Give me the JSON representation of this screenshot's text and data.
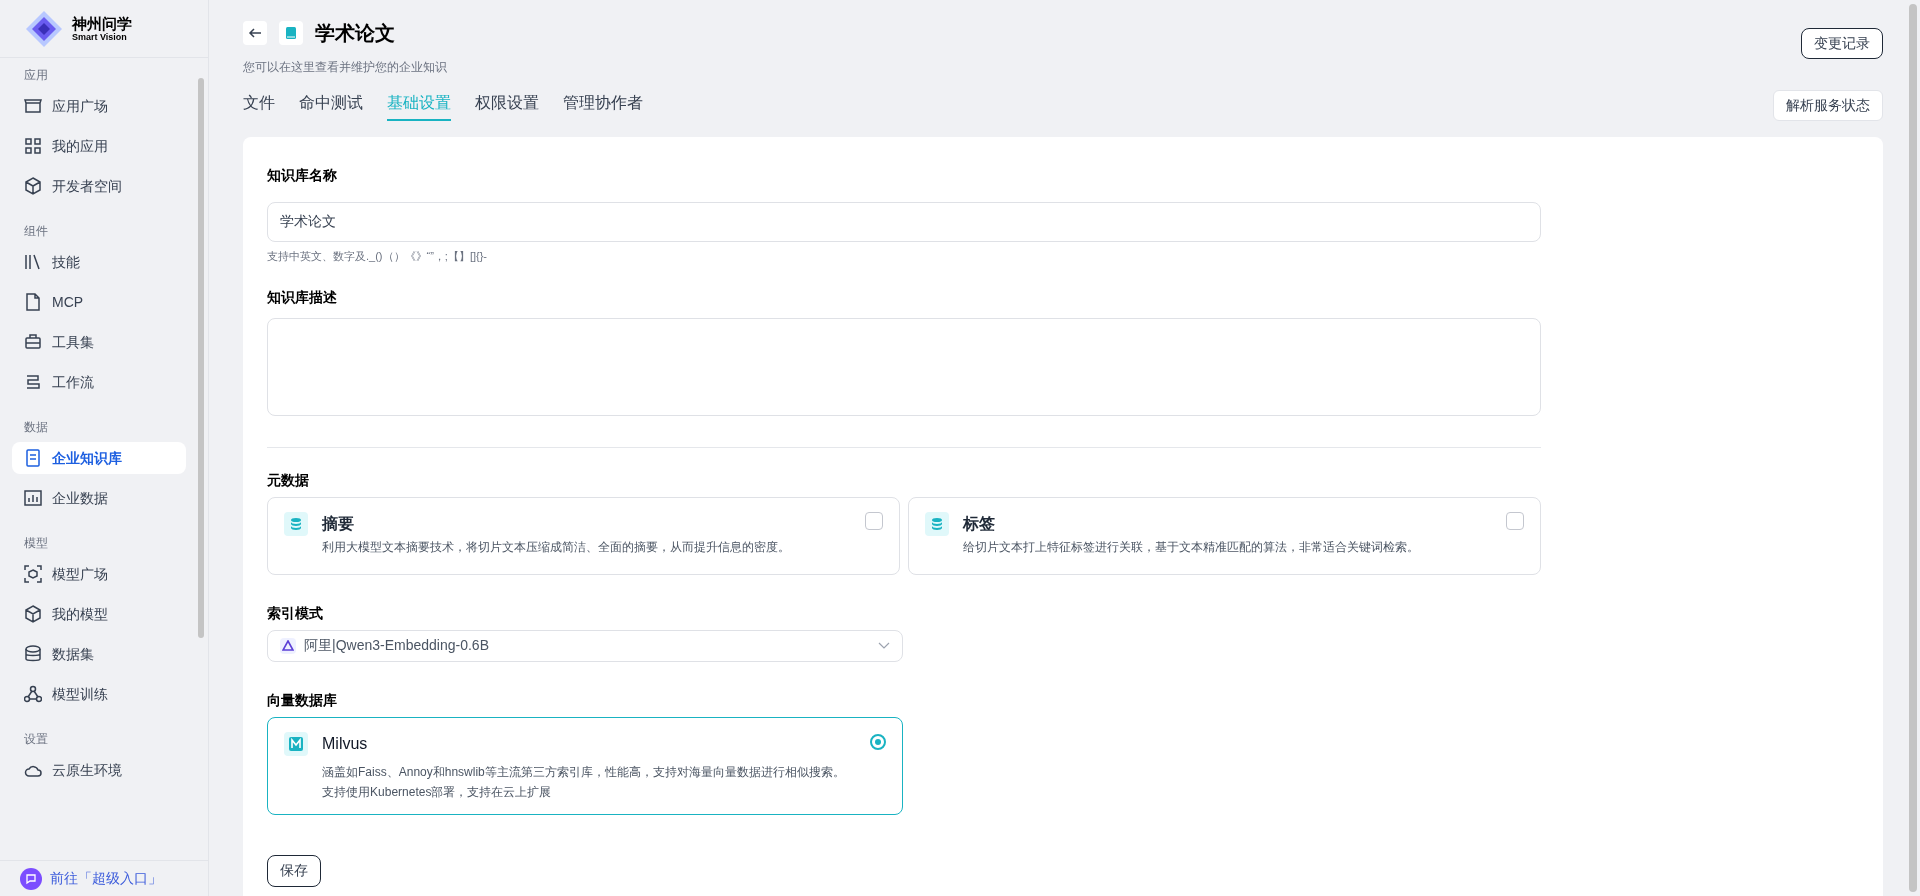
{
  "brand": {
    "name": "神州问学",
    "subtitle": "Smart Vision"
  },
  "sidebar": {
    "sections": [
      {
        "title": "应用",
        "items": [
          {
            "label": "应用广场",
            "selected": false
          },
          {
            "label": "我的应用",
            "selected": false
          },
          {
            "label": "开发者空间",
            "selected": false
          }
        ]
      },
      {
        "title": "组件",
        "items": [
          {
            "label": "技能",
            "selected": false
          },
          {
            "label": "MCP",
            "selected": false
          },
          {
            "label": "工具集",
            "selected": false
          },
          {
            "label": "工作流",
            "selected": false
          }
        ]
      },
      {
        "title": "数据",
        "items": [
          {
            "label": "企业知识库",
            "selected": true
          },
          {
            "label": "企业数据",
            "selected": false
          }
        ]
      },
      {
        "title": "模型",
        "items": [
          {
            "label": "模型广场",
            "selected": false
          },
          {
            "label": "我的模型",
            "selected": false
          },
          {
            "label": "数据集",
            "selected": false
          },
          {
            "label": "模型训练",
            "selected": false
          }
        ]
      },
      {
        "title": "设置",
        "items": [
          {
            "label": "云原生环境",
            "selected": false
          }
        ]
      }
    ],
    "footer": "前往「超级入口」"
  },
  "header": {
    "title": "学术论文",
    "subtitle": "您可以在这里查看并维护您的企业知识",
    "history_button": "变更记录",
    "status_button": "解析服务状态"
  },
  "tabs": [
    {
      "label": "文件",
      "selected": false
    },
    {
      "label": "命中测试",
      "selected": false
    },
    {
      "label": "基础设置",
      "selected": true
    },
    {
      "label": "权限设置",
      "selected": false
    },
    {
      "label": "管理协作者",
      "selected": false
    }
  ],
  "form": {
    "name_label": "知识库名称",
    "name_value": "学术论文",
    "name_hint": "支持中英文、数字及._()（）《》“”，;【】[]{}-",
    "desc_label": "知识库描述",
    "metadata_label": "元数据",
    "metadata": [
      {
        "title": "摘要",
        "description": "利用大模型文本摘要技术，将切片文本压缩成简洁、全面的摘要，从而提升信息的密度。",
        "checked": false
      },
      {
        "title": "标签",
        "description": "给切片文本打上特征标签进行关联，基于文本精准匹配的算法，非常适合关键词检索。",
        "checked": false
      }
    ],
    "index_label": "索引模式",
    "index_value": "阿里|Qwen3-Embedding-0.6B",
    "vector_label": "向量数据库",
    "vector_dbs": [
      {
        "name": "Milvus",
        "description": "涵盖如Faiss、Annoy和hnswlib等主流第三方索引库，性能高，支持对海量向量数据进行相似搜索。支持使用Kubernetes部署，支持在云上扩展",
        "selected": true
      }
    ],
    "save_button": "保存"
  }
}
